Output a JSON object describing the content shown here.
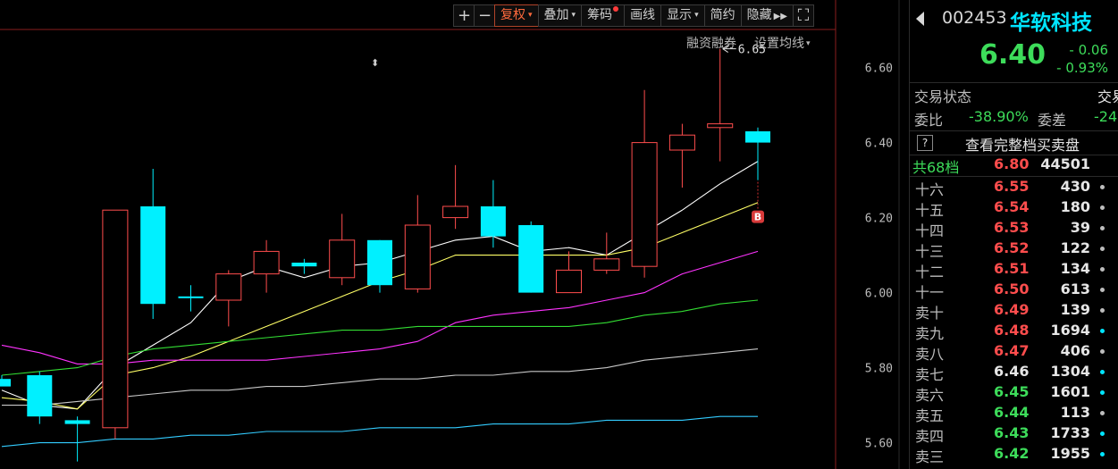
{
  "toolbar": {
    "items": [
      {
        "label": "+",
        "name": "zoom-in-button",
        "square": true
      },
      {
        "label": "−",
        "name": "zoom-out-button",
        "square": true
      },
      {
        "label": "复权",
        "name": "adjust-button",
        "caret": true,
        "active": true
      },
      {
        "label": "叠加",
        "name": "overlay-button",
        "caret": true
      },
      {
        "label": "筹码",
        "name": "chips-button",
        "dot": true
      },
      {
        "label": "画线",
        "name": "draw-line-button"
      },
      {
        "label": "显示",
        "name": "display-button",
        "caret": true
      },
      {
        "label": "简约",
        "name": "simple-button"
      },
      {
        "label": "隐藏",
        "name": "hide-button",
        "arrows": true
      },
      {
        "label": "⛶",
        "name": "fullscreen-button",
        "square": true
      }
    ],
    "margin_label": "融资融券",
    "ma_setting_label": "设置均线"
  },
  "stock": {
    "code": "002453",
    "name": "华软科技",
    "price": "6.40",
    "change": "- 0.06",
    "change_pct": "- 0.93%"
  },
  "status": {
    "label": "交易状态",
    "value": "交易"
  },
  "ratio": {
    "label": "委比",
    "value": "-38.90%",
    "diff_label": "委差",
    "diff_value": "-24"
  },
  "full_book": {
    "icon": "?",
    "label": "查看完整档买卖盘"
  },
  "levels": [
    {
      "name": "共68档",
      "price": "6.80",
      "volume": "44501",
      "color": "red",
      "dot": ""
    },
    {
      "name": "十六",
      "price": "6.55",
      "volume": "430",
      "color": "red",
      "dot": "gray"
    },
    {
      "name": "十五",
      "price": "6.54",
      "volume": "180",
      "color": "red",
      "dot": "gray"
    },
    {
      "name": "十四",
      "price": "6.53",
      "volume": "39",
      "color": "red",
      "dot": "gray"
    },
    {
      "name": "十三",
      "price": "6.52",
      "volume": "122",
      "color": "red",
      "dot": "gray"
    },
    {
      "name": "十二",
      "price": "6.51",
      "volume": "134",
      "color": "red",
      "dot": "gray"
    },
    {
      "name": "十一",
      "price": "6.50",
      "volume": "613",
      "color": "red",
      "dot": "gray"
    },
    {
      "name": "卖十",
      "price": "6.49",
      "volume": "139",
      "color": "red",
      "dot": "gray"
    },
    {
      "name": "卖九",
      "price": "6.48",
      "volume": "1694",
      "color": "red",
      "dot": "cyan"
    },
    {
      "name": "卖八",
      "price": "6.47",
      "volume": "406",
      "color": "red",
      "dot": "gray"
    },
    {
      "name": "卖七",
      "price": "6.46",
      "volume": "1304",
      "color": "white",
      "dot": "cyan"
    },
    {
      "name": "卖六",
      "price": "6.45",
      "volume": "1601",
      "color": "green",
      "dot": "cyan"
    },
    {
      "name": "卖五",
      "price": "6.44",
      "volume": "113",
      "color": "green",
      "dot": "gray"
    },
    {
      "name": "卖四",
      "price": "6.43",
      "volume": "1733",
      "color": "green",
      "dot": "cyan"
    },
    {
      "name": "卖三",
      "price": "6.42",
      "volume": "1955",
      "color": "green",
      "dot": "cyan"
    }
  ],
  "colors": {
    "up": "#ff4d4d",
    "down": "#00f0ff",
    "ma5": "#ffffff",
    "ma10": "#ffff66",
    "ma20": "#ff33ff",
    "ma30": "#33dd33",
    "ma60": "#c8c8c8",
    "ma120": "#33ccff"
  },
  "chart_data": {
    "type": "candlestick",
    "ylim": [
      5.53,
      6.78
    ],
    "y_ticks": [
      "6.60",
      "6.40",
      "6.20",
      "6.00",
      "5.80",
      "5.60"
    ],
    "max_label": "6.65",
    "buy_marker": "B",
    "candles": [
      {
        "o": 5.77,
        "h": 5.78,
        "l": 5.76,
        "c": 5.75
      },
      {
        "o": 5.78,
        "h": 5.79,
        "l": 5.65,
        "c": 5.67
      },
      {
        "o": 5.66,
        "h": 5.67,
        "l": 5.55,
        "c": 5.65
      },
      {
        "o": 5.64,
        "h": 6.22,
        "l": 5.61,
        "c": 6.22
      },
      {
        "o": 6.23,
        "h": 6.33,
        "l": 5.93,
        "c": 5.97
      },
      {
        "o": 5.99,
        "h": 6.02,
        "l": 5.95,
        "c": 5.99
      },
      {
        "o": 5.98,
        "h": 6.06,
        "l": 5.91,
        "c": 6.05
      },
      {
        "o": 6.05,
        "h": 6.14,
        "l": 6.0,
        "c": 6.11
      },
      {
        "o": 6.08,
        "h": 6.09,
        "l": 6.05,
        "c": 6.07
      },
      {
        "o": 6.04,
        "h": 6.21,
        "l": 6.02,
        "c": 6.14
      },
      {
        "o": 6.14,
        "h": 6.14,
        "l": 6.0,
        "c": 6.02
      },
      {
        "o": 6.01,
        "h": 6.26,
        "l": 6.0,
        "c": 6.18
      },
      {
        "o": 6.2,
        "h": 6.34,
        "l": 6.17,
        "c": 6.23
      },
      {
        "o": 6.23,
        "h": 6.3,
        "l": 6.12,
        "c": 6.15
      },
      {
        "o": 6.18,
        "h": 6.19,
        "l": 6.0,
        "c": 6.0
      },
      {
        "o": 6.0,
        "h": 6.11,
        "l": 6.0,
        "c": 6.06
      },
      {
        "o": 6.06,
        "h": 6.16,
        "l": 6.05,
        "c": 6.09
      },
      {
        "o": 6.07,
        "h": 6.54,
        "l": 6.04,
        "c": 6.4
      },
      {
        "o": 6.38,
        "h": 6.45,
        "l": 6.28,
        "c": 6.42
      },
      {
        "o": 6.44,
        "h": 6.65,
        "l": 6.35,
        "c": 6.45
      },
      {
        "o": 6.43,
        "h": 6.44,
        "l": 6.3,
        "c": 6.4
      }
    ],
    "ma": {
      "ma5": [
        5.74,
        5.7,
        5.69,
        5.8,
        5.86,
        5.92,
        6.03,
        6.07,
        6.04,
        6.07,
        6.08,
        6.11,
        6.14,
        6.15,
        6.11,
        6.12,
        6.1,
        6.16,
        6.22,
        6.29,
        6.35
      ],
      "ma10": [
        5.72,
        5.71,
        5.69,
        5.78,
        5.8,
        5.83,
        5.87,
        5.91,
        5.95,
        5.99,
        6.03,
        6.06,
        6.1,
        6.1,
        6.1,
        6.1,
        6.1,
        6.12,
        6.16,
        6.2,
        6.24
      ],
      "ma20": [
        5.86,
        5.84,
        5.81,
        5.81,
        5.82,
        5.82,
        5.82,
        5.82,
        5.83,
        5.84,
        5.85,
        5.87,
        5.92,
        5.94,
        5.95,
        5.96,
        5.98,
        6.0,
        6.05,
        6.08,
        6.11
      ],
      "ma30": [
        5.78,
        5.79,
        5.8,
        5.83,
        5.85,
        5.86,
        5.87,
        5.88,
        5.89,
        5.9,
        5.9,
        5.91,
        5.91,
        5.91,
        5.91,
        5.91,
        5.92,
        5.94,
        5.95,
        5.97,
        5.98
      ],
      "ma60": [
        5.7,
        5.7,
        5.71,
        5.72,
        5.73,
        5.74,
        5.74,
        5.75,
        5.75,
        5.76,
        5.77,
        5.77,
        5.78,
        5.78,
        5.79,
        5.79,
        5.8,
        5.82,
        5.83,
        5.84,
        5.85
      ],
      "ma120": [
        5.59,
        5.6,
        5.6,
        5.61,
        5.61,
        5.62,
        5.62,
        5.63,
        5.63,
        5.63,
        5.64,
        5.64,
        5.64,
        5.65,
        5.65,
        5.65,
        5.66,
        5.66,
        5.66,
        5.67,
        5.67
      ]
    }
  }
}
